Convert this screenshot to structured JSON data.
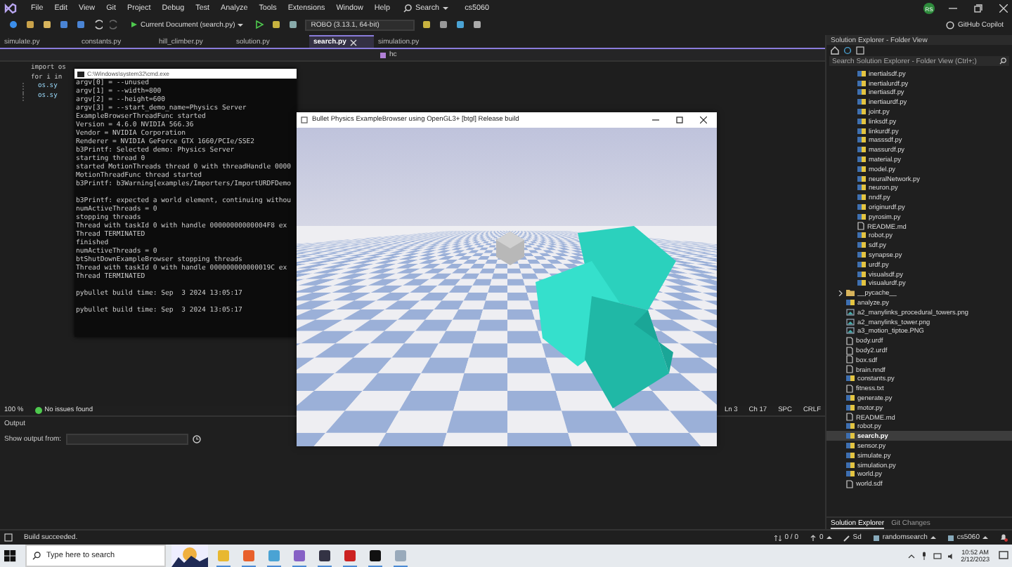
{
  "menu_bar": {
    "items": [
      "File",
      "Edit",
      "View",
      "Git",
      "Project",
      "Debug",
      "Test",
      "Analyze",
      "Tools",
      "Extensions",
      "Window",
      "Help"
    ],
    "search": "Search",
    "solution_name": "cs5060",
    "account_initials": "RS"
  },
  "toolbar": {
    "run_target": "Current Document (search.py)",
    "environment": "ROBO (3.13.1, 64-bit)",
    "copilot": "GitHub Copilot"
  },
  "tabs": [
    {
      "label": "simulate.py",
      "selected": false
    },
    {
      "label": "constants.py",
      "selected": false
    },
    {
      "label": "hill_climber.py",
      "selected": false
    },
    {
      "label": "solution.py",
      "selected": false
    },
    {
      "label": "search.py",
      "selected": true
    },
    {
      "label": "simulation.py",
      "selected": false
    }
  ],
  "editor": {
    "navigation": "hc",
    "code_lines": [
      {
        "text": "import os",
        "kind": "top"
      },
      {
        "text": "for i in",
        "kind": "top"
      },
      {
        "text": "os.sy",
        "kind": "block"
      },
      {
        "text": "os.sy",
        "kind": "block"
      }
    ]
  },
  "editor_status": {
    "zoom": "100 %",
    "issues": "No issues found",
    "line": "Ln 3",
    "column": "Ch 17",
    "whitespace": "SPC",
    "line_endings": "CRLF"
  },
  "output": {
    "title": "Output",
    "source_label": "Show output from:"
  },
  "status_bar": {
    "message": "Build succeeded.",
    "errors": "0 / 0",
    "pending": "0",
    "changes": "Sd",
    "branch": "randomsearch",
    "repository": "cs5060"
  },
  "solution_explorer": {
    "title": "Solution Explorer - Folder View",
    "search_placeholder": "Search Solution Explorer - Folder View (Ctrl+;)",
    "tree": [
      {
        "kind": "group",
        "children": [
          {
            "label": "inertialsdf.py",
            "kind": "py",
            "selected": false
          },
          {
            "label": "inertialurdf.py",
            "kind": "py",
            "selected": false
          },
          {
            "label": "inertiasdf.py",
            "kind": "py",
            "selected": false
          },
          {
            "label": "inertiaurdf.py",
            "kind": "py",
            "selected": false
          },
          {
            "label": "joint.py",
            "kind": "py",
            "selected": false
          },
          {
            "label": "linksdf.py",
            "kind": "py",
            "selected": false
          },
          {
            "label": "linkurdf.py",
            "kind": "py",
            "selected": false
          },
          {
            "label": "masssdf.py",
            "kind": "py",
            "selected": false
          },
          {
            "label": "massurdf.py",
            "kind": "py",
            "selected": false
          },
          {
            "label": "material.py",
            "kind": "py",
            "selected": false
          },
          {
            "label": "model.py",
            "kind": "py",
            "selected": false
          },
          {
            "label": "neuralNetwork.py",
            "kind": "py",
            "selected": false
          },
          {
            "label": "neuron.py",
            "kind": "py",
            "selected": false
          },
          {
            "label": "nndf.py",
            "kind": "py",
            "selected": false
          },
          {
            "label": "originurdf.py",
            "kind": "py",
            "selected": false
          },
          {
            "label": "pyrosim.py",
            "kind": "py",
            "selected": false
          },
          {
            "label": "README.md",
            "kind": "doc",
            "selected": false
          },
          {
            "label": "robot.py",
            "kind": "py",
            "selected": false
          },
          {
            "label": "sdf.py",
            "kind": "py",
            "selected": false
          },
          {
            "label": "synapse.py",
            "kind": "py",
            "selected": false
          },
          {
            "label": "urdf.py",
            "kind": "py",
            "selected": false
          },
          {
            "label": "visualsdf.py",
            "kind": "py",
            "selected": false
          },
          {
            "label": "visualurdf.py",
            "kind": "py",
            "selected": false
          }
        ]
      },
      {
        "label": "__pycache__",
        "kind": "folder",
        "expanded": false,
        "selected": false
      },
      {
        "label": "analyze.py",
        "kind": "py",
        "selected": false
      },
      {
        "label": "a2_manylinks_procedural_towers.png",
        "kind": "image",
        "selected": false
      },
      {
        "label": "a2_manylinks_tower.png",
        "kind": "image",
        "selected": false
      },
      {
        "label": "a3_motion_tiptoe.PNG",
        "kind": "image",
        "selected": false
      },
      {
        "label": "body.urdf",
        "kind": "doc",
        "selected": false
      },
      {
        "label": "body2.urdf",
        "kind": "doc",
        "selected": false
      },
      {
        "label": "box.sdf",
        "kind": "doc",
        "selected": false
      },
      {
        "label": "brain.nndf",
        "kind": "doc",
        "selected": false
      },
      {
        "label": "constants.py",
        "kind": "py",
        "selected": false
      },
      {
        "label": "fitness.txt",
        "kind": "doc",
        "selected": false
      },
      {
        "label": "generate.py",
        "kind": "py",
        "selected": false
      },
      {
        "label": "motor.py",
        "kind": "py",
        "selected": false
      },
      {
        "label": "README.md",
        "kind": "doc",
        "selected": false
      },
      {
        "label": "robot.py",
        "kind": "py",
        "selected": false
      },
      {
        "label": "search.py",
        "kind": "py",
        "selected": true
      },
      {
        "label": "sensor.py",
        "kind": "py",
        "selected": false
      },
      {
        "label": "simulate.py",
        "kind": "py",
        "selected": false
      },
      {
        "label": "simulation.py",
        "kind": "py",
        "selected": false
      },
      {
        "label": "world.py",
        "kind": "py",
        "selected": false
      },
      {
        "label": "world.sdf",
        "kind": "doc",
        "selected": false
      }
    ],
    "tabs": [
      {
        "label": "Solution Explorer",
        "selected": true
      },
      {
        "label": "Git Changes",
        "selected": false
      }
    ]
  },
  "console_window": {
    "title": "C:\\Windows\\system32\\cmd.exe",
    "lines": [
      {
        "text": "argv[0] = --unused",
        "spaced": false
      },
      {
        "text": "argv[1] = --width=800",
        "spaced": false
      },
      {
        "text": "argv[2] = --height=600",
        "spaced": false
      },
      {
        "text": "argv[3] = --start_demo_name=Physics Server",
        "spaced": false
      },
      {
        "text": "ExampleBrowserThreadFunc started",
        "spaced": false
      },
      {
        "text": "Version = 4.6.0 NVIDIA 566.36",
        "spaced": false
      },
      {
        "text": "Vendor = NVIDIA Corporation",
        "spaced": false
      },
      {
        "text": "Renderer = NVIDIA GeForce GTX 1660/PCIe/SSE2",
        "spaced": false
      },
      {
        "text": "b3Printf: Selected demo: Physics Server",
        "spaced": false
      },
      {
        "text": "starting thread 0",
        "spaced": false
      },
      {
        "text": "started MotionThreads thread 0 with threadHandle 0000",
        "spaced": false
      },
      {
        "text": "MotionThreadFunc thread started",
        "spaced": false
      },
      {
        "text": "b3Printf: b3Warning[examples/Importers/ImportURDFDemo",
        "spaced": false
      },
      {
        "text": "b3Printf: expected a world element, continuing withou",
        "spaced": true
      },
      {
        "text": "numActiveThreads = 0",
        "spaced": false
      },
      {
        "text": "stopping threads",
        "spaced": false
      },
      {
        "text": "Thread with taskId 0 with handle 00000000000004F8 ex",
        "spaced": false
      },
      {
        "text": "Thread TERMINATED",
        "spaced": false
      },
      {
        "text": "finished",
        "spaced": false
      },
      {
        "text": "numActiveThreads = 0",
        "spaced": false
      },
      {
        "text": "btShutDownExampleBrowser stopping threads",
        "spaced": false
      },
      {
        "text": "Thread with taskId 0 with handle 000000000000019C ex",
        "spaced": false
      },
      {
        "text": "Thread TERMINATED",
        "spaced": false
      },
      {
        "text": "pybullet build time: Sep  3 2024 13:05:17",
        "spaced": true
      },
      {
        "text": "pybullet build time: Sep  3 2024 13:05:17",
        "spaced": true
      }
    ]
  },
  "physics_window": {
    "title": "Bullet Physics ExampleBrowser using OpenGL3+ [btgl] Release build"
  },
  "taskbar": {
    "search_placeholder": "Type here to search",
    "time": "10:52 AM",
    "date": "2/12/2023"
  }
}
